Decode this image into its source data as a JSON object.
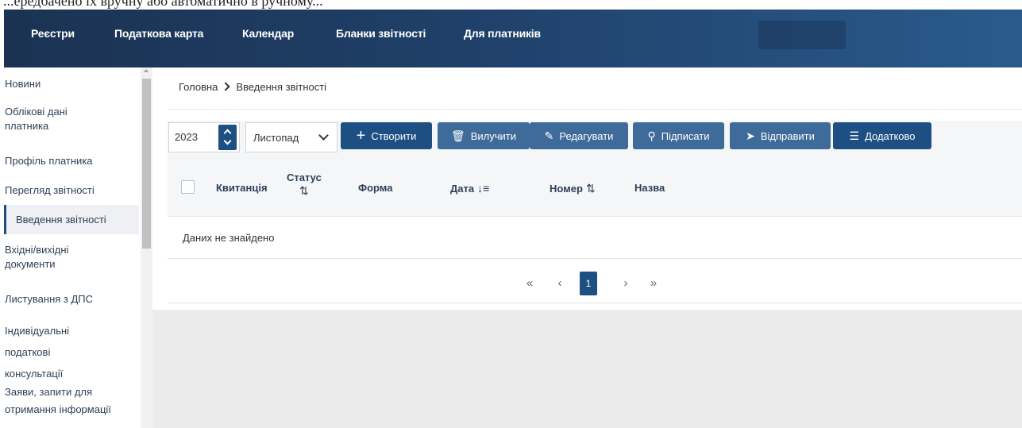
{
  "caption": "...ередбачено їх вручну або автоматично в ручному...",
  "topnav": {
    "items": [
      "Реєстри",
      "Податкова карта",
      "Календар",
      "Бланки звітності",
      "Для платників"
    ]
  },
  "sidebar": {
    "items": [
      {
        "label": "Новини"
      },
      {
        "label": "Облікові дані платника"
      },
      {
        "label": "Профіль платника"
      },
      {
        "label": "Перегляд звітності"
      },
      {
        "label": "Введення звітності",
        "active": true
      },
      {
        "label": "Вхідні/вихідні документи"
      },
      {
        "label": "Листування з ДПС"
      },
      {
        "label": "Індивідуальні податкові консультації"
      },
      {
        "label": "Заяви, запити для отримання інформації"
      }
    ]
  },
  "breadcrumb": {
    "home": "Головна",
    "current": "Введення звітності"
  },
  "toolbar": {
    "year": "2023",
    "month": "Листопад",
    "buttons": {
      "create": "Створити",
      "delete": "Вилучити",
      "edit": "Редагувати",
      "sign": "Підписати",
      "send": "Відправити",
      "more": "Додатково"
    }
  },
  "table": {
    "columns": {
      "receipt": "Квитанція",
      "status": "Статус",
      "form": "Форма",
      "date": "Дата",
      "number": "Номер",
      "name": "Назва"
    },
    "empty": "Даних не знайдено"
  },
  "pagination": {
    "first": "«",
    "prev": "‹",
    "current": "1",
    "next": "›",
    "last": "»"
  },
  "colors": {
    "primary": "#1d4f82",
    "nav_start": "#1b3252",
    "nav_end": "#2a5a8c"
  }
}
